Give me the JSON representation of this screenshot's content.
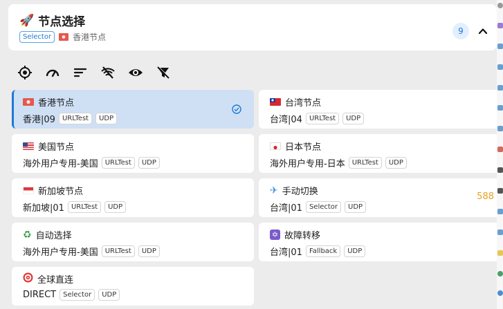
{
  "header": {
    "title": "节点选择",
    "type_tag": "Selector",
    "current": "香港节点",
    "count": "9"
  },
  "toolbar": {
    "icons": [
      "locate-icon",
      "speed-test-icon",
      "sort-icon",
      "hide-unavailable-icon",
      "show-icon",
      "filter-off-icon"
    ]
  },
  "proxies": [
    {
      "name": "香港节点",
      "detail": "香港|09",
      "type": "URLTest",
      "udp": "UDP",
      "selected": true
    },
    {
      "name": "台湾节点",
      "detail": "台湾|04",
      "type": "URLTest",
      "udp": "UDP"
    },
    {
      "name": "美国节点",
      "detail": "海外用户专用-美国",
      "type": "URLTest",
      "udp": "UDP"
    },
    {
      "name": "日本节点",
      "detail": "海外用户专用-日本",
      "type": "URLTest",
      "udp": "UDP"
    },
    {
      "name": "新加坡节点",
      "detail": "新加坡|01",
      "type": "URLTest",
      "udp": "UDP"
    },
    {
      "name": "手动切换",
      "detail": "台湾|01",
      "type": "Selector",
      "udp": "UDP",
      "delay": "588"
    },
    {
      "name": "自动选择",
      "detail": "海外用户专用-美国",
      "type": "URLTest",
      "udp": "UDP"
    },
    {
      "name": "故障转移",
      "detail": "台湾|01",
      "type": "Fallback",
      "udp": "UDP"
    },
    {
      "name": "全球直连",
      "detail": "DIRECT",
      "type": "Selector",
      "udp": "UDP"
    }
  ],
  "colors": {
    "accent": "#1e78d6",
    "selected_bg": "#cfe0f5",
    "delay": "#e8a025"
  }
}
